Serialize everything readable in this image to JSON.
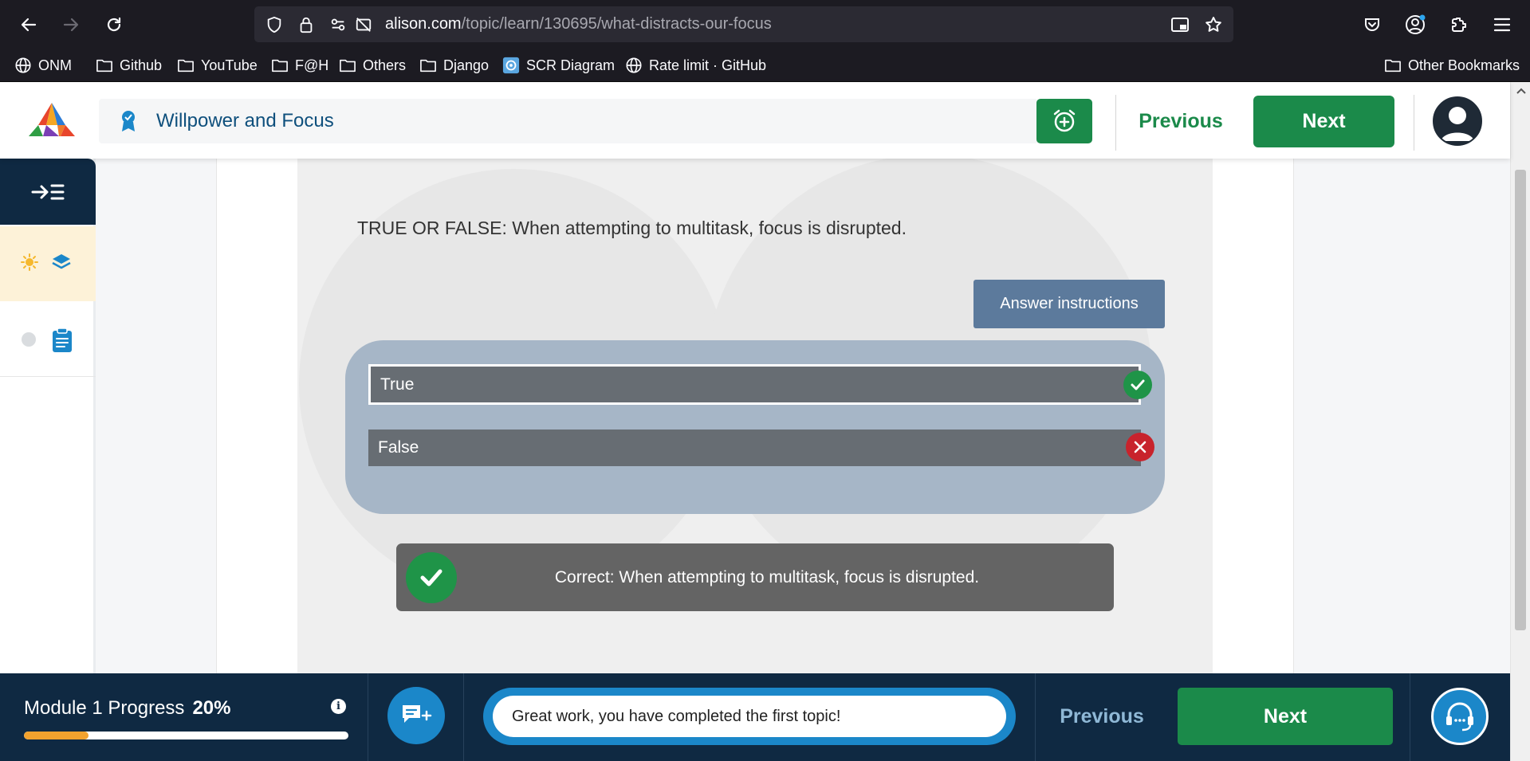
{
  "browser": {
    "url_host": "alison.com",
    "url_path": "/topic/learn/130695/what-distracts-our-focus",
    "bookmarks": [
      {
        "label": "ONM",
        "icon": "globe-icon"
      },
      {
        "label": "Github",
        "icon": "folder-icon"
      },
      {
        "label": "YouTube",
        "icon": "folder-icon"
      },
      {
        "label": "F@H",
        "icon": "folder-icon"
      },
      {
        "label": "Others",
        "icon": "folder-icon"
      },
      {
        "label": "Django",
        "icon": "folder-icon"
      },
      {
        "label": "SCR Diagram",
        "icon": "diagram-favicon-icon"
      },
      {
        "label": "Rate limit · GitHub",
        "icon": "globe-icon"
      }
    ],
    "other_bookmarks": "Other Bookmarks"
  },
  "header": {
    "course_title": "Willpower and Focus",
    "previous_label": "Previous",
    "next_label": "Next"
  },
  "lesson": {
    "question": "TRUE OR FALSE: When attempting to multitask, focus is disrupted.",
    "answer_instructions_label": "Answer instructions",
    "options": [
      {
        "label": "True",
        "result": "correct"
      },
      {
        "label": "False",
        "result": "incorrect"
      }
    ],
    "feedback": "Correct: When attempting to multitask, focus is disrupted."
  },
  "footer": {
    "module_label": "Module 1 Progress",
    "progress_text": "20%",
    "progress_fraction": 0.2,
    "message": "Great work, you have completed the first topic!",
    "previous_label": "Previous",
    "next_label": "Next"
  },
  "colors": {
    "brand_green": "#1b8a4a",
    "navy": "#0f2942",
    "accent_blue": "#1b87c9",
    "progress_orange": "#f2a22e",
    "correct_green": "#1f9448",
    "incorrect_red": "#c8232c"
  }
}
